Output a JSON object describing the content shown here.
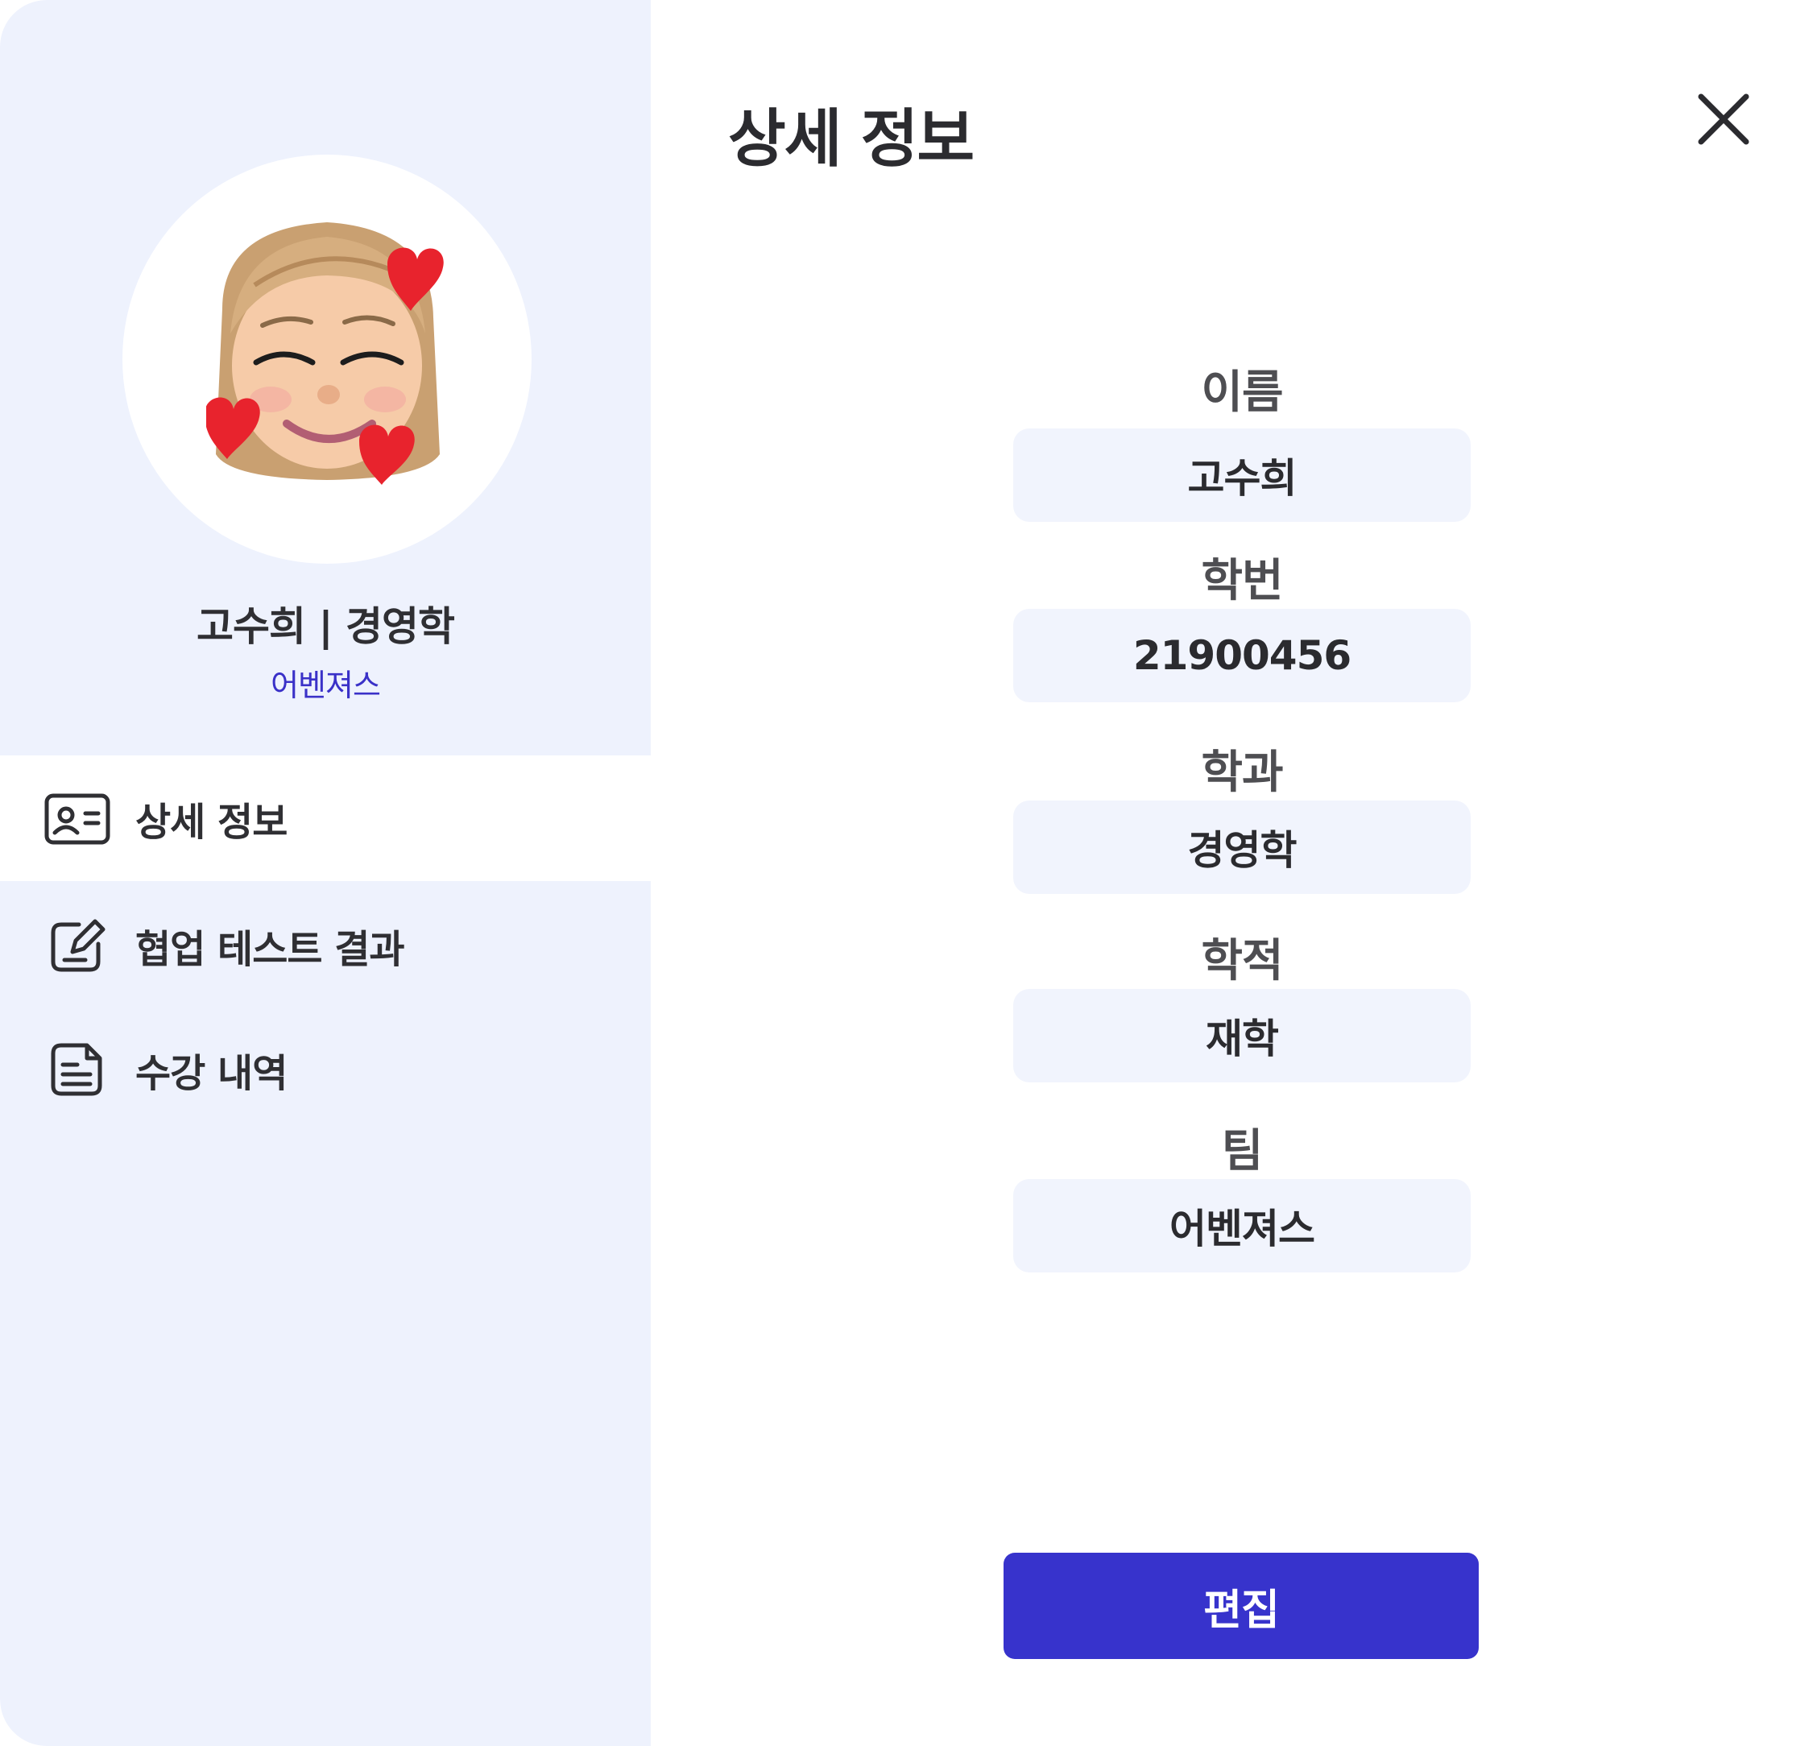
{
  "header": {
    "title": "상세 정보",
    "close_icon": "close-icon"
  },
  "profile": {
    "avatar": "memoji-avatar-with-hearts",
    "name_major": "고수희 | 경영학",
    "team": "어벤져스"
  },
  "sidebar": {
    "items": [
      {
        "label": "상세 정보",
        "icon": "id-card-icon",
        "active": true
      },
      {
        "label": "협업 테스트 결과",
        "icon": "edit-note-icon",
        "active": false
      },
      {
        "label": "수강 내역",
        "icon": "document-list-icon",
        "active": false
      }
    ]
  },
  "fields": [
    {
      "label": "이름",
      "value": "고수희"
    },
    {
      "label": "학번",
      "value": "21900456"
    },
    {
      "label": "학과",
      "value": "경영학"
    },
    {
      "label": "학적",
      "value": "재학"
    },
    {
      "label": "팀",
      "value": "어벤져스"
    }
  ],
  "actions": {
    "edit_label": "편집"
  },
  "colors": {
    "sidebar_bg": "#eef2fd",
    "field_bg": "#f1f4fd",
    "accent": "#3733cc",
    "team_text": "#3a31c8"
  }
}
